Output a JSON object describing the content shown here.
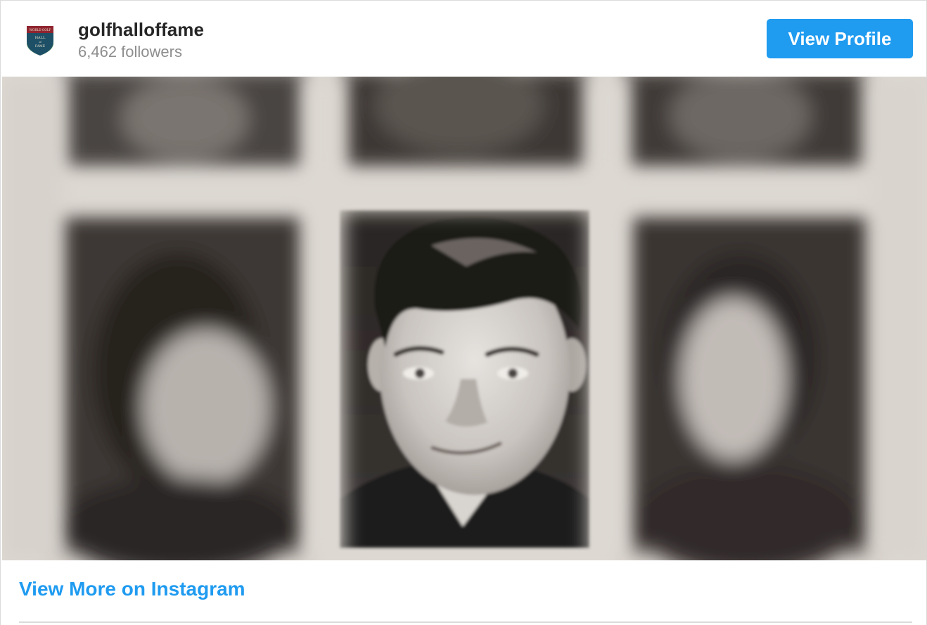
{
  "profile": {
    "username": "golfhalloffame",
    "followers": "6,462 followers",
    "logo_text": [
      "WORLD GOLF",
      "HALL",
      "of",
      "FAME"
    ]
  },
  "header": {
    "view_profile_label": "View Profile"
  },
  "post": {
    "image_icon": "yearbook-photo"
  },
  "footer": {
    "view_more_label": "View More on Instagram"
  },
  "colors": {
    "accent": "#1f9bf0",
    "username": "#262626",
    "secondary_text": "#8e8e8e",
    "border": "#dbdbdb"
  }
}
